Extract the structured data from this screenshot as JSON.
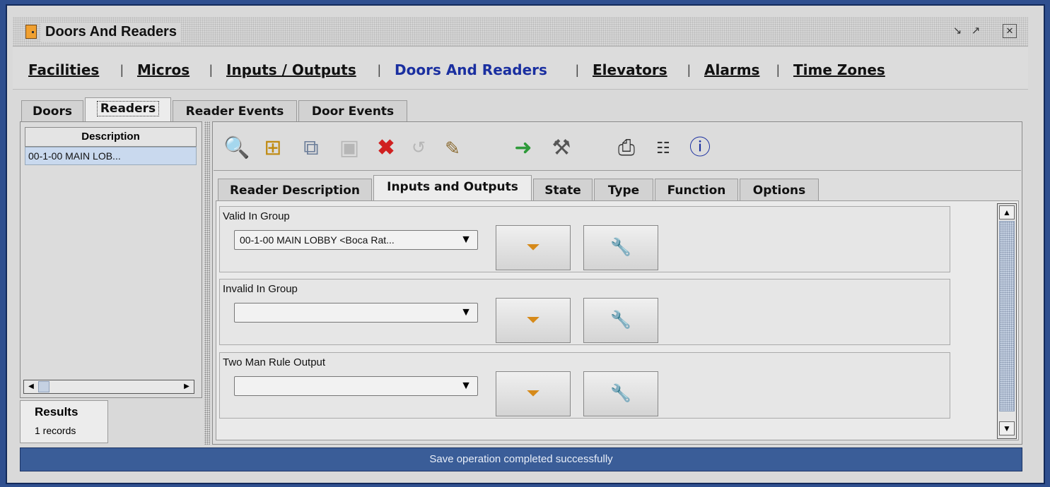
{
  "window": {
    "title": "Doors And Readers",
    "controls": [
      "restore-icon",
      "maximize-icon",
      "close-icon"
    ]
  },
  "nav": {
    "items": [
      "Facilities",
      "Micros",
      "Inputs / Outputs",
      "Doors And Readers",
      "Elevators",
      "Alarms",
      "Time Zones"
    ],
    "active": "Doors And Readers",
    "separator": "|"
  },
  "tabs": {
    "items": [
      "Doors",
      "Readers",
      "Reader Events",
      "Door Events"
    ],
    "active": "Readers"
  },
  "list": {
    "header": "Description",
    "rows": [
      "00-1-00 MAIN LOB..."
    ]
  },
  "results": {
    "title": "Results",
    "count": "1 records"
  },
  "toolbar": {
    "icons": [
      "search-icon",
      "add-icon",
      "copy-icon",
      "save-icon",
      "delete-icon",
      "undo-icon",
      "edit-icon",
      "go-icon",
      "tools-icon",
      "print-icon",
      "list-icon",
      "help-icon"
    ],
    "disabled": [
      "save-icon",
      "undo-icon"
    ]
  },
  "inner_tabs": {
    "items": [
      "Reader Description",
      "Inputs and Outputs",
      "State",
      "Type",
      "Function",
      "Options"
    ],
    "active": "Inputs and Outputs"
  },
  "groups": [
    {
      "label": "Valid In Group",
      "value": "00-1-00 MAIN LOBBY <Boca Rat..."
    },
    {
      "label": "Invalid In Group",
      "value": ""
    },
    {
      "label": "Two Man Rule Output",
      "value": ""
    }
  ],
  "status": "Save operation completed successfully",
  "colors": {
    "titlebar_bg": "#d6d6d6",
    "active_nav": "#1a2fa0",
    "status_bg": "#3a5d98",
    "delete": "#d02020",
    "go": "#2e9a3a"
  }
}
